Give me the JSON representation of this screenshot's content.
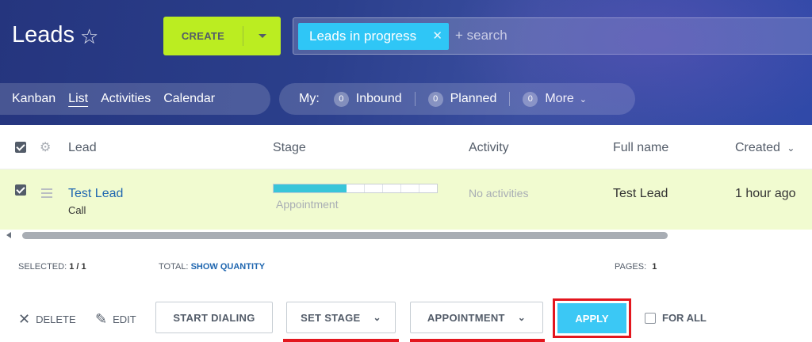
{
  "header": {
    "title": "Leads",
    "create_label": "CREATE",
    "filter_chip": "Leads in progress",
    "search_placeholder": "+ search"
  },
  "view_tabs": [
    "Kanban",
    "List",
    "Activities",
    "Calendar"
  ],
  "active_view": "List",
  "counters": {
    "my_label": "My:",
    "items": [
      {
        "count": "0",
        "label": "Inbound"
      },
      {
        "count": "0",
        "label": "Planned"
      },
      {
        "count": "0",
        "label": "More"
      }
    ]
  },
  "grid": {
    "columns": [
      "Lead",
      "Stage",
      "Activity",
      "Full name",
      "Created"
    ],
    "sort_indicator": "⌄",
    "rows": [
      {
        "lead": "Test Lead",
        "lead_sub": "Call",
        "stage": "Appointment",
        "stage_progress_segments": 4,
        "stage_total_segments": 9,
        "activity": "No activities",
        "full_name": "Test Lead",
        "created": "1 hour ago",
        "selected": true
      }
    ]
  },
  "footer": {
    "selected_label": "SELECTED:",
    "selected_value": "1 / 1",
    "total_label": "TOTAL:",
    "total_link": "SHOW QUANTITY",
    "pages_label": "PAGES:",
    "pages_value": "1"
  },
  "actions": {
    "delete": "DELETE",
    "edit": "EDIT",
    "start_dialing": "START DIALING",
    "set_stage": "SET STAGE",
    "stage_select": "APPOINTMENT",
    "apply": "APPLY",
    "for_all": "FOR ALL"
  },
  "colors": {
    "create_button": "#bbed21",
    "filter_chip": "#2fc6f6",
    "row_highlight": "#f1fbd0",
    "stage_fill": "#39c5d9",
    "apply_button": "#3bc8f5",
    "highlight_red": "#e3161e"
  }
}
